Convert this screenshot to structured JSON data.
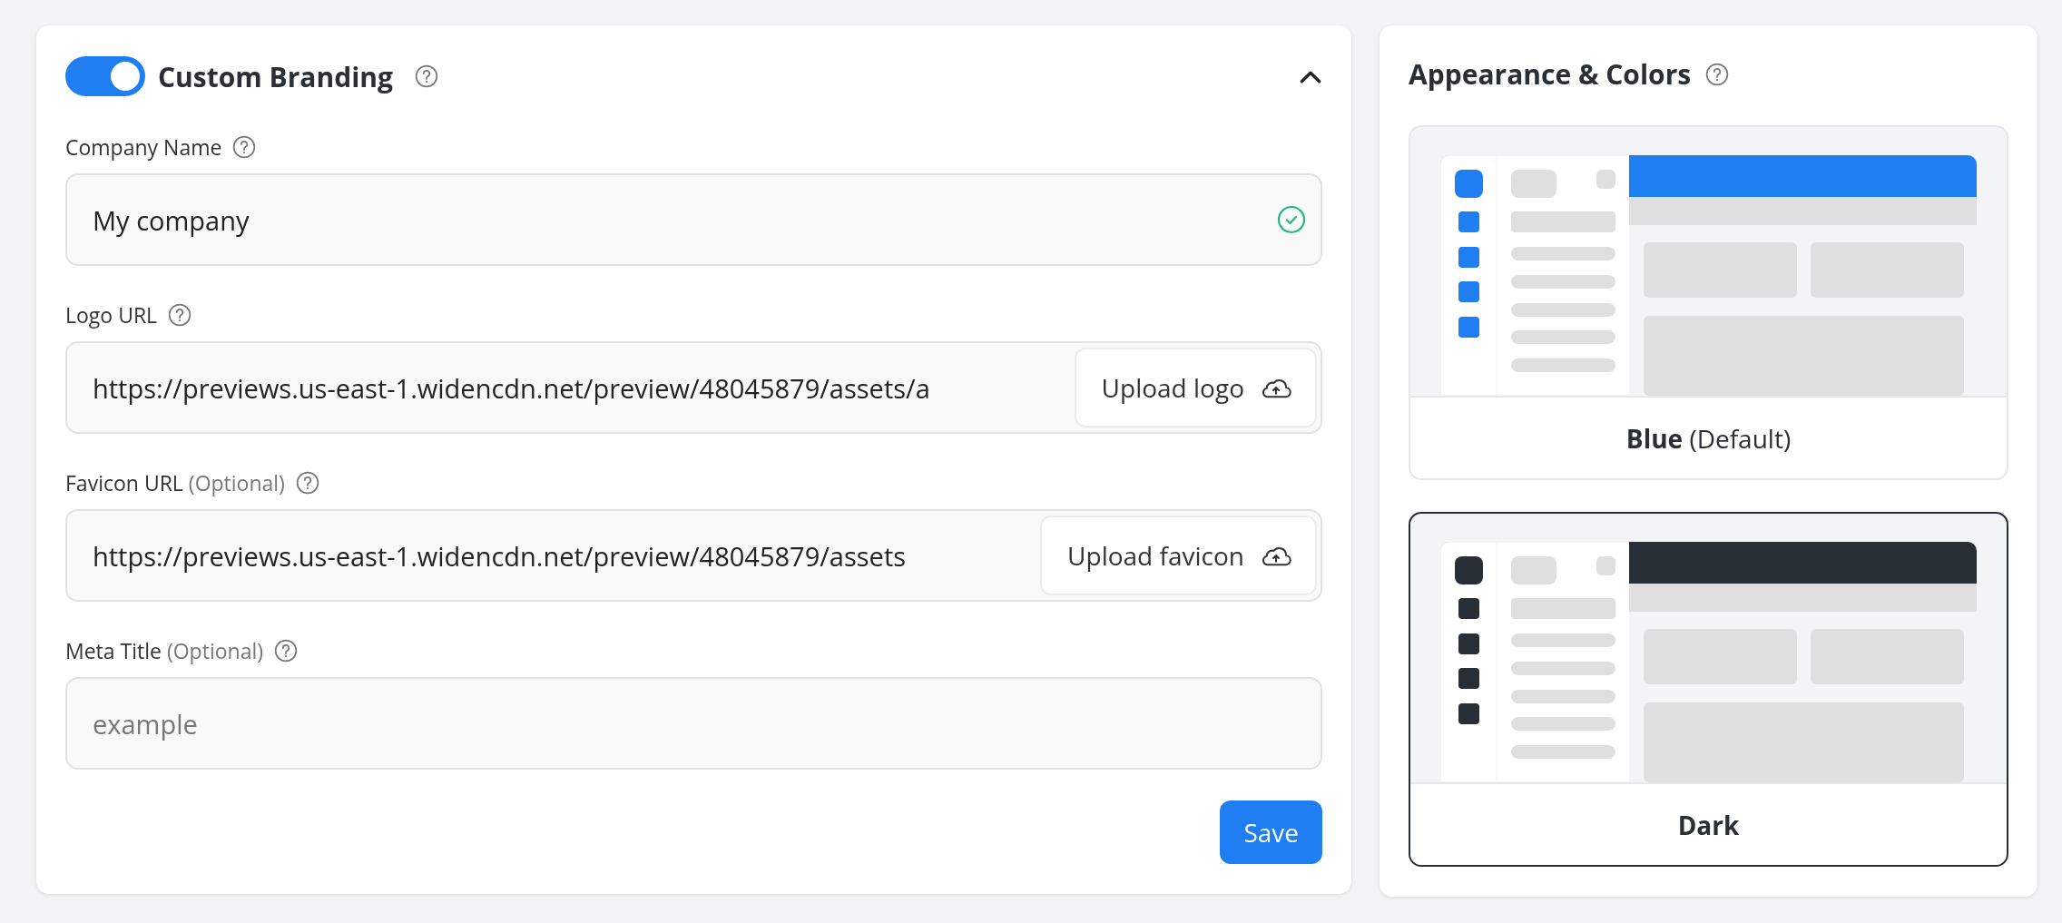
{
  "branding": {
    "enabled": true,
    "title": "Custom Branding",
    "expanded": true,
    "fields": [
      {
        "kind": "text",
        "label": "Company Name",
        "value": "My company",
        "valid": true
      },
      {
        "kind": "upload",
        "label": "Logo URL",
        "value": "https://previews.us-east-1.widencdn.net/preview/48045879/assets/a",
        "button": "Upload logo"
      },
      {
        "kind": "upload",
        "label": "Favicon URL",
        "optional": "(Optional)",
        "value": "https://previews.us-east-1.widencdn.net/preview/48045879/assets",
        "button": "Upload favicon"
      },
      {
        "kind": "text",
        "label": "Meta Title",
        "optional": "(Optional)",
        "placeholder": "example"
      }
    ],
    "save": "Save"
  },
  "appearance": {
    "title": "Appearance & Colors",
    "themes": [
      {
        "name": "Blue",
        "note": "(Default)",
        "color": "#1f7ff2",
        "selected": false
      },
      {
        "name": "Dark",
        "color": "#272e36",
        "selected": true
      }
    ]
  }
}
